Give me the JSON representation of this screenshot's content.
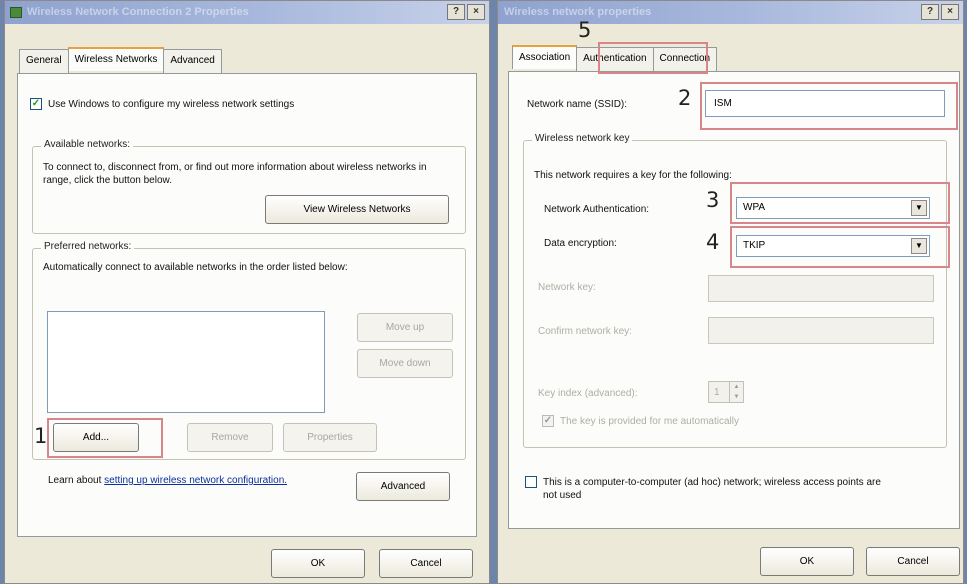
{
  "left": {
    "title": "Wireless Network Connection 2 Properties",
    "tabs": [
      "General",
      "Wireless Networks",
      "Advanced"
    ],
    "use_windows_label": "Use Windows to configure my wireless network settings",
    "available": {
      "label": "Available networks:",
      "desc": "To connect to, disconnect from, or find out more information about wireless networks in range, click the button below.",
      "view_button": "View Wireless Networks"
    },
    "preferred": {
      "label": "Preferred networks:",
      "desc": "Automatically connect to available networks in the order listed below:",
      "move_up": "Move up",
      "move_down": "Move down",
      "add": "Add...",
      "remove": "Remove",
      "properties": "Properties"
    },
    "learn_prefix": "Learn about",
    "learn_link": "setting up wireless network configuration.",
    "advanced_button": "Advanced",
    "ok": "OK",
    "cancel": "Cancel"
  },
  "right": {
    "title": "Wireless network properties",
    "tabs": [
      "Association",
      "Authentication",
      "Connection"
    ],
    "ssid_label": "Network name (SSID):",
    "ssid_value": "ISM",
    "key_group": "Wireless network key",
    "key_desc": "This network requires a key for the following:",
    "auth_label": "Network Authentication:",
    "auth_value": "WPA",
    "enc_label": "Data encryption:",
    "enc_value": "TKIP",
    "netkey_label": "Network key:",
    "confirm_label": "Confirm network key:",
    "keyindex_label": "Key index (advanced):",
    "keyindex_value": "1",
    "auto_key_label": "The key is provided for me automatically",
    "adhoc_label": "This is a computer-to-computer (ad hoc) network; wireless access points are not used",
    "ok": "OK",
    "cancel": "Cancel"
  },
  "title_buttons": [
    "?",
    "×"
  ],
  "annotations": [
    "1",
    "2",
    "3",
    "4",
    "5"
  ]
}
